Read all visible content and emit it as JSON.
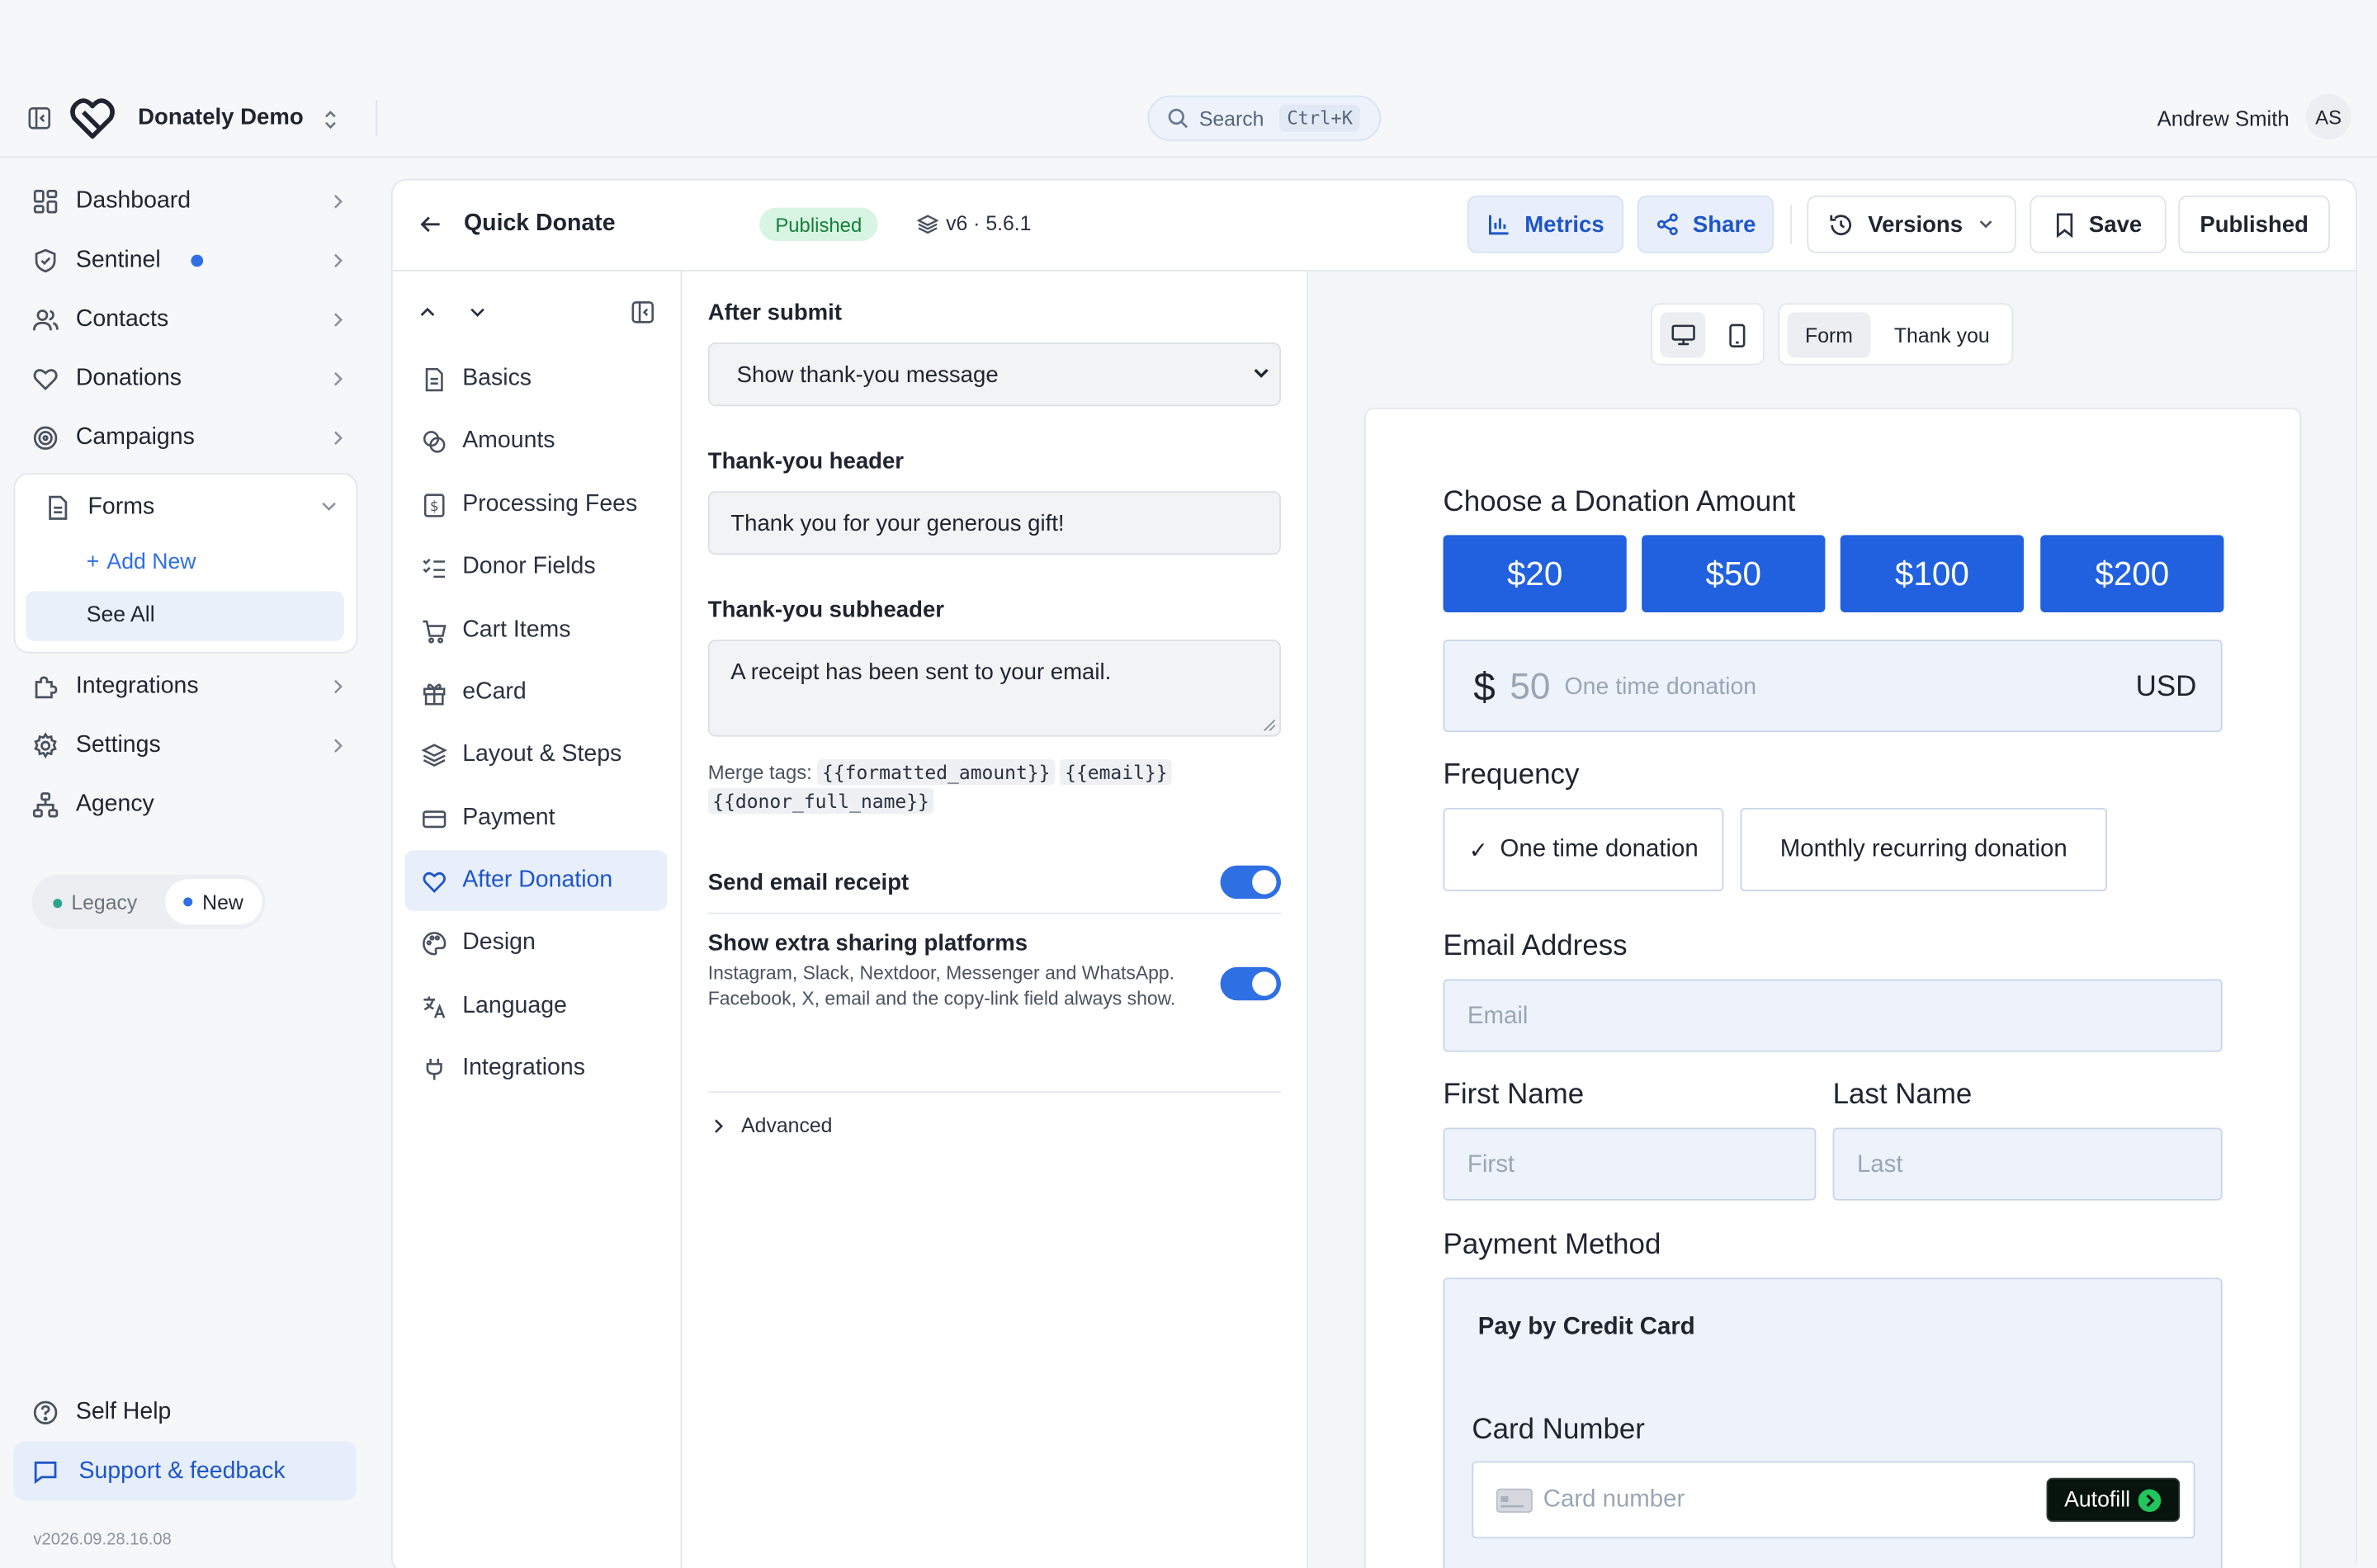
{
  "app": {
    "workspace": "Donately Demo",
    "user_name": "Andrew Smith",
    "user_initials": "AS",
    "version": "v2026.09.28.16.08"
  },
  "search": {
    "label": "Search",
    "shortcut": "Ctrl+K"
  },
  "sidebar": {
    "items": [
      {
        "label": "Dashboard",
        "icon": "dashboard-icon"
      },
      {
        "label": "Sentinel",
        "icon": "shield-icon"
      },
      {
        "label": "Contacts",
        "icon": "users-icon"
      },
      {
        "label": "Donations",
        "icon": "heart-icon"
      },
      {
        "label": "Campaigns",
        "icon": "target-icon"
      },
      {
        "label": "Forms",
        "icon": "file-icon"
      },
      {
        "label": "Integrations",
        "icon": "puzzle-icon"
      },
      {
        "label": "Settings",
        "icon": "gear-icon"
      },
      {
        "label": "Agency",
        "icon": "org-icon"
      }
    ],
    "forms_sub": {
      "add_new": "Add New",
      "see_all": "See All"
    },
    "ui_toggle": {
      "legacy": "Legacy",
      "new": "New"
    },
    "self_help": "Self Help",
    "support": "Support & feedback"
  },
  "header": {
    "form_name": "Quick Donate",
    "status_badge": "Published",
    "version": "v6 · 5.6.1",
    "metrics": "Metrics",
    "share": "Share",
    "versions": "Versions",
    "save": "Save",
    "published": "Published"
  },
  "steps": [
    {
      "label": "Basics",
      "icon": "document-icon"
    },
    {
      "label": "Amounts",
      "icon": "coins-icon"
    },
    {
      "label": "Processing Fees",
      "icon": "receipt-icon"
    },
    {
      "label": "Donor Fields",
      "icon": "list-check-icon"
    },
    {
      "label": "Cart Items",
      "icon": "cart-icon"
    },
    {
      "label": "eCard",
      "icon": "gift-icon"
    },
    {
      "label": "Layout & Steps",
      "icon": "layers-icon"
    },
    {
      "label": "Payment",
      "icon": "card-icon"
    },
    {
      "label": "After Donation",
      "icon": "heart-icon"
    },
    {
      "label": "Design",
      "icon": "palette-icon"
    },
    {
      "label": "Language",
      "icon": "translate-icon"
    },
    {
      "label": "Integrations",
      "icon": "plug-icon"
    }
  ],
  "settings": {
    "after_submit_label": "After submit",
    "after_submit_value": "Show thank-you message",
    "header_label": "Thank-you header",
    "header_value": "Thank you for your generous gift!",
    "subheader_label": "Thank-you subheader",
    "subheader_value": "A receipt has been sent to your email.",
    "merge_tags_label": "Merge tags:",
    "merge_tags": [
      "{{formatted_amount}}",
      "{{email}}",
      "{{donor_full_name}}"
    ],
    "send_receipt_label": "Send email receipt",
    "send_receipt_on": true,
    "sharing_label": "Show extra sharing platforms",
    "sharing_desc": "Instagram, Slack, Nextdoor, Messenger and WhatsApp. Facebook, X, email and the copy-link field always show.",
    "sharing_on": true,
    "advanced": "Advanced"
  },
  "preview": {
    "tabs": [
      "Form",
      "Thank you"
    ],
    "choose_amount": "Choose a Donation Amount",
    "amounts": [
      "$20",
      "$50",
      "$100",
      "$200"
    ],
    "currency_symbol": "$",
    "amount_placeholder": "50",
    "amount_hint": "One time donation",
    "currency": "USD",
    "frequency_label": "Frequency",
    "freq_one_time": "One time donation",
    "freq_monthly": "Monthly recurring donation",
    "email_label": "Email Address",
    "email_placeholder": "Email",
    "first_label": "First Name",
    "first_placeholder": "First",
    "last_label": "Last Name",
    "last_placeholder": "Last",
    "payment_label": "Payment Method",
    "pay_card": "Pay by Credit Card",
    "card_label": "Card Number",
    "card_placeholder": "Card number",
    "autofill": "Autofill"
  },
  "colors": {
    "accent": "#2161e0",
    "link": "#1e56c9",
    "success_bg": "#d8f4e2",
    "success_text": "#15803d"
  }
}
